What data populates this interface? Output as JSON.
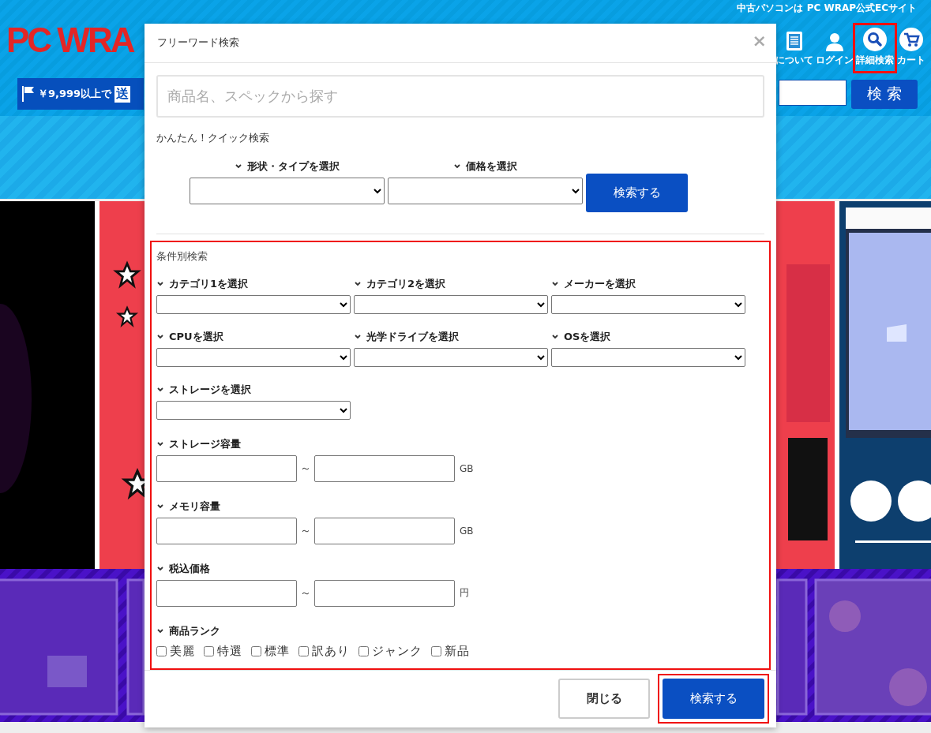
{
  "header": {
    "tagline": "中古パソコンは PC WRAP公式ECサイト",
    "logo": "PC WRA",
    "promo": {
      "text": "￥9,999以上で",
      "badge": "送"
    },
    "nav": [
      {
        "label": "について",
        "kind": "document",
        "highlighted": false
      },
      {
        "label": "ログイン",
        "kind": "person",
        "highlighted": false
      },
      {
        "label": "詳細検索",
        "kind": "search",
        "highlighted": true
      },
      {
        "label": "カート",
        "kind": "cart",
        "highlighted": false
      }
    ],
    "search_button": "検 索"
  },
  "modal": {
    "title": "フリーワード検索",
    "close": "×",
    "search": {
      "placeholder": "商品名、スペックから探す"
    },
    "quick": {
      "title": "かんたん！クイック検索",
      "selects": [
        "形状・タイプを選択",
        "価格を選択"
      ],
      "button": "検索する"
    },
    "conditions": {
      "title": "条件別検索",
      "highlighted": true,
      "selects": [
        "カテゴリ1を選択",
        "カテゴリ2を選択",
        "メーカーを選択",
        "CPUを選択",
        "光学ドライブを選択",
        "OSを選択",
        "ストレージを選択"
      ],
      "ranges": [
        {
          "label": "ストレージ容量",
          "separator": "～",
          "unit": "GB"
        },
        {
          "label": "メモリ容量",
          "separator": "～",
          "unit": "GB"
        },
        {
          "label": "税込価格",
          "separator": "～",
          "unit": "円"
        }
      ],
      "rank": {
        "label": "商品ランク",
        "options": [
          {
            "label": "美麗",
            "checked": false
          },
          {
            "label": "特選",
            "checked": false
          },
          {
            "label": "標準",
            "checked": false
          },
          {
            "label": "訳あり",
            "checked": false
          },
          {
            "label": "ジャンク",
            "checked": false
          },
          {
            "label": "新品",
            "checked": false
          }
        ]
      }
    },
    "footer": [
      {
        "label": "閉じる",
        "kind": "secondary",
        "highlighted": false
      },
      {
        "label": "検索する",
        "kind": "primary",
        "highlighted": true
      }
    ]
  }
}
